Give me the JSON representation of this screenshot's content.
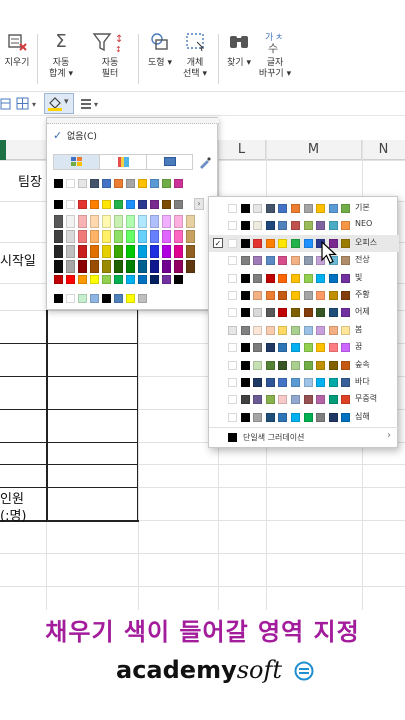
{
  "ribbon": {
    "items": [
      {
        "label1": "지우기",
        "label2": "",
        "icon": "eraser-icon"
      },
      {
        "label1": "자동",
        "label2": "합계",
        "icon": "sigma-icon"
      },
      {
        "label1": "자동",
        "label2": "필터",
        "icon": "filter-icon"
      },
      {
        "label1": "도형",
        "label2": "",
        "icon": "shapes-icon"
      },
      {
        "label1": "개체",
        "label2": "선택",
        "icon": "select-objects-icon"
      },
      {
        "label1": "찾기",
        "label2": "",
        "icon": "binoculars-icon"
      },
      {
        "label1": "글자",
        "label2": "바꾸기",
        "icon": "replace-text-icon"
      }
    ]
  },
  "columns": {
    "l": "L",
    "m": "M",
    "n": "N"
  },
  "sheet": {
    "team_leader": "팀장",
    "start_date": "시작일",
    "headcount_1": "인원",
    "headcount_2": "(:명)"
  },
  "fill_panel": {
    "none_label": "없음(C)",
    "theme_rows": [
      [
        "#000000",
        "#ffffff",
        "#e7e6e6",
        "#44546a",
        "#4472c4",
        "#ed7d31",
        "#a5a5a5",
        "#ffc000",
        "#5b9bd5",
        "#70ad47",
        "#cc3399"
      ],
      [
        "#000000",
        "#ffffff",
        "#e3342f",
        "#ff7f00",
        "#ffe600",
        "#24b24a",
        "#1e90ff",
        "#2b3990",
        "#7a2a8f",
        "#7a4b00",
        "#808080"
      ]
    ],
    "gradient_cols": [
      [
        "#595959",
        "#404040",
        "#262626",
        "#0d0d0d"
      ],
      [
        "#f2f2f2",
        "#d9d9d9",
        "#bfbfbf",
        "#a6a6a6"
      ],
      [
        "#f8b4b4",
        "#f07a7a",
        "#c81e1e",
        "#8b0000"
      ],
      [
        "#ffd8b0",
        "#ffb366",
        "#e07000",
        "#994d00"
      ],
      [
        "#fff9b0",
        "#fff066",
        "#e6cf00",
        "#998a00"
      ],
      [
        "#c8f0b0",
        "#8fe066",
        "#3aa800",
        "#1f6000"
      ],
      [
        "#b0ffb0",
        "#66ff66",
        "#00c800",
        "#008000"
      ],
      [
        "#b0e8ff",
        "#66d0ff",
        "#00a0e0",
        "#006090"
      ],
      [
        "#b0c0ff",
        "#6680ff",
        "#2030e0",
        "#101890"
      ],
      [
        "#f0b0ff",
        "#e066ff",
        "#b000e0",
        "#700090"
      ],
      [
        "#ffb0e0",
        "#ff66c0",
        "#e00090",
        "#900060"
      ],
      [
        "#e8d0a0",
        "#c8a060",
        "#906020",
        "#603810"
      ]
    ],
    "standard_row": [
      "#c00000",
      "#ff0000",
      "#ff9900",
      "#ffff00",
      "#92d050",
      "#00b050",
      "#00b0f0",
      "#0070c0",
      "#002060",
      "#7030a0",
      "#000000"
    ],
    "recent_row": [
      "#000000",
      "#ffffff",
      "#c6efce",
      "#8db4e2",
      "#000000",
      "#4f81bd",
      "#ffff00",
      "#bfbfbf"
    ]
  },
  "theme_menu": {
    "selected_index": 2,
    "gradient_option": "단일색 그러데이션",
    "themes": [
      {
        "name": "기본",
        "colors": [
          "#ffffff",
          "#000000",
          "#e7e6e6",
          "#44546a",
          "#4472c4",
          "#ed7d31",
          "#a5a5a5",
          "#ffc000",
          "#5b9bd5",
          "#70ad47"
        ]
      },
      {
        "name": "NEO",
        "colors": [
          "#ffffff",
          "#000000",
          "#eeece1",
          "#1f497d",
          "#4f81bd",
          "#c0504d",
          "#9bbb59",
          "#8064a2",
          "#4bacc6",
          "#f79646"
        ]
      },
      {
        "name": "오피스",
        "colors": [
          "#ffffff",
          "#000000",
          "#e3342f",
          "#ff7f00",
          "#ffe600",
          "#24b24a",
          "#1e90ff",
          "#2b3990",
          "#7a2a8f",
          "#9a7d00"
        ]
      },
      {
        "name": "전상",
        "colors": [
          "#ffffff",
          "#808080",
          "#9e7ab8",
          "#5a8ac6",
          "#d64f8a",
          "#f4b183",
          "#8e9aaf",
          "#c3a2d6",
          "#6cbad8",
          "#b08c6a"
        ]
      },
      {
        "name": "빛",
        "colors": [
          "#ffffff",
          "#000000",
          "#7f7f7f",
          "#c00000",
          "#ff6600",
          "#ffc000",
          "#92d050",
          "#00b0f0",
          "#0070c0",
          "#7030a0"
        ]
      },
      {
        "name": "주황",
        "colors": [
          "#ffffff",
          "#000000",
          "#f4b183",
          "#ed7d31",
          "#c55a11",
          "#ffc000",
          "#a5a5a5",
          "#ff9966",
          "#bf8f00",
          "#843c0c"
        ]
      },
      {
        "name": "어제",
        "colors": [
          "#ffffff",
          "#000000",
          "#d9d9d9",
          "#595959",
          "#c00000",
          "#7f6000",
          "#833c0b",
          "#375623",
          "#1f4e79",
          "#7030a0"
        ]
      },
      {
        "name": "봄",
        "colors": [
          "#e7e6e6",
          "#808080",
          "#fbe5d6",
          "#f8cbad",
          "#ffd966",
          "#a9d08e",
          "#9bc2e6",
          "#c9a0dc",
          "#f4b084",
          "#ffe699"
        ]
      },
      {
        "name": "꿈",
        "colors": [
          "#ffffff",
          "#000000",
          "#7b7b7b",
          "#1f3864",
          "#2e75b6",
          "#00b0f0",
          "#92d050",
          "#ffc000",
          "#ff7c80",
          "#cc66ff"
        ]
      },
      {
        "name": "숲속",
        "colors": [
          "#ffffff",
          "#000000",
          "#c6e0b4",
          "#548235",
          "#375623",
          "#a9d08e",
          "#70ad47",
          "#bf9000",
          "#806000",
          "#c65911"
        ]
      },
      {
        "name": "바다",
        "colors": [
          "#ffffff",
          "#000000",
          "#1f3864",
          "#2f5597",
          "#4472c4",
          "#5b9bd5",
          "#9dc3e6",
          "#00b0f0",
          "#00a9a5",
          "#375e97"
        ]
      },
      {
        "name": "무중력",
        "colors": [
          "#ffffff",
          "#404040",
          "#6b5b95",
          "#88b04b",
          "#f7cac9",
          "#92a8d1",
          "#955251",
          "#b565a7",
          "#009b77",
          "#dd4124"
        ]
      },
      {
        "name": "심해",
        "colors": [
          "#ffffff",
          "#000000",
          "#a5a5a5",
          "#1f4e79",
          "#2e75b6",
          "#00b0f0",
          "#00b050",
          "#7f7f7f",
          "#203864",
          "#0070c0"
        ]
      }
    ]
  },
  "caption": "채우기 색이 들어갈 영역 지정",
  "logo": {
    "bold": "academy",
    "italic": "soft"
  }
}
